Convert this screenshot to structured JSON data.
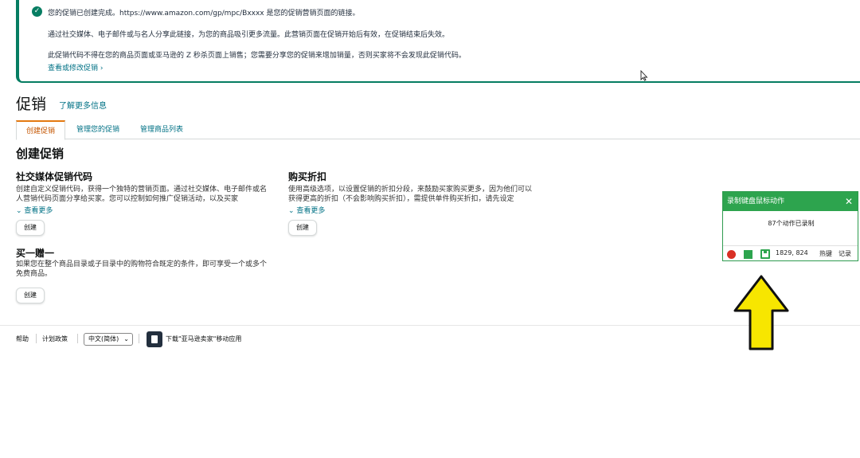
{
  "banner": {
    "line1": "您的促销已创建完成。https://www.amazon.com/gp/mpc/Bxxxx 是您的促销营销页面的链接。",
    "line2": "通过社交媒体、电子邮件或与名人分享此链接，为您的商品吸引更多流量。此营销页面在促销开始后有效，在促销结束后失效。",
    "line3": "此促销代码不得在您的商品页面或亚马逊的 Z 秒杀页面上销售；您需要分享您的促销来增加销量，否则买家将不会发现此促销代码。",
    "link": "查看或修改促销 ›"
  },
  "header": {
    "title": "促销",
    "learn_more": "了解更多信息"
  },
  "tabs": [
    "创建促销",
    "管理您的促销",
    "管理商品列表"
  ],
  "section": {
    "title": "创建促销"
  },
  "cards": [
    {
      "title": "社交媒体促销代码",
      "desc": "创建自定义促销代码，获得一个独特的营销页面。通过社交媒体、电子邮件或名人营销代码页面分享给买家。您可以控制如何推广促销活动，以及买家",
      "see_more": "查看更多",
      "button": "创建"
    },
    {
      "title": "购买折扣",
      "desc": "使用高级选项，以设置促销的折扣分段，来鼓励买家购买更多，因为他们可以获得更高的折扣（不会影响购买折扣），需提供单件购买折扣，请先设定",
      "see_more": "查看更多",
      "button": "创建"
    },
    {
      "title": "买一赠一",
      "desc": "如果您在整个商品目录或子目录中的购物符合既定的条件，即可享受一个或多个免费商品。",
      "button": "创建"
    }
  ],
  "footer": {
    "help": "帮助",
    "policy": "计划政策",
    "language": "中文(简体)",
    "app_link": "下载\"亚马逊卖家\"移动应用"
  },
  "recorder": {
    "title": "录制键盘鼠标动作",
    "close": "✕",
    "count_text": "87个动作已录制",
    "coords": "1829, 824",
    "hotkey": "热键",
    "log": "记录",
    "colors": {
      "header": "#2da44e",
      "record": "#d93025"
    }
  },
  "arrow_color": "#f7e600"
}
